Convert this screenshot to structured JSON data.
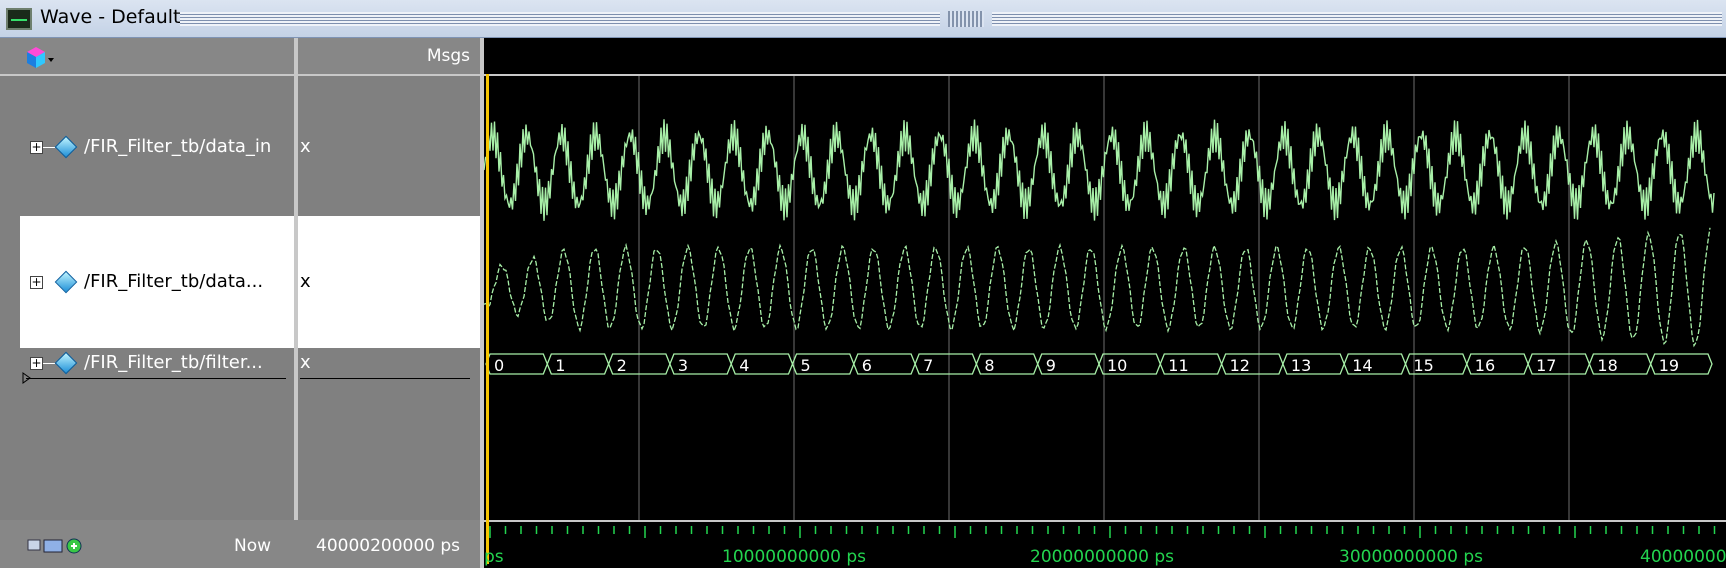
{
  "window": {
    "title": "Wave - Default"
  },
  "header": {
    "msgs_label": "Msgs"
  },
  "signals": [
    {
      "name": "/FIR_Filter_tb/data_in",
      "value": "x"
    },
    {
      "name": "/FIR_Filter_tb/data...",
      "value": "x"
    },
    {
      "name": "/FIR_Filter_tb/filter...",
      "value": "x"
    }
  ],
  "footer": {
    "now_label": "Now",
    "now_time": "40000200000 ps"
  },
  "timeline": {
    "ticks": [
      "ps",
      "10000000000 ps",
      "20000000000 ps",
      "30000000000 ps",
      "40000000"
    ],
    "bus_values": [
      "0",
      "1",
      "2",
      "3",
      "4",
      "5",
      "6",
      "7",
      "8",
      "9",
      "10",
      "11",
      "12",
      "13",
      "14",
      "15",
      "16",
      "17",
      "18",
      "19"
    ]
  },
  "colors": {
    "wave": "#a8f0a8",
    "cursor": "#f5c400",
    "tick": "#23d44f"
  },
  "icons": {
    "window": "wave-window-icon",
    "toolbar": "cube-dropdown-icon",
    "signal": "diamond-signal-icon"
  }
}
